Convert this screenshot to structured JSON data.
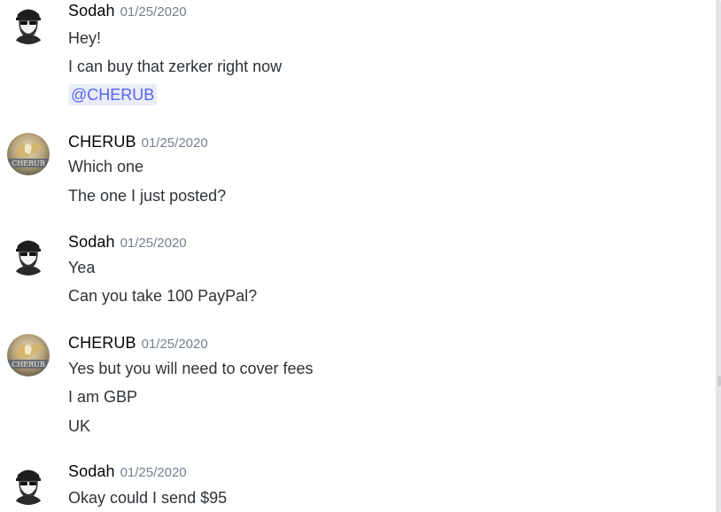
{
  "messages": [
    {
      "author": "Sodah",
      "timestamp": "01/25/2020",
      "avatar": "sodah-avatar",
      "lines": [
        "Hey!",
        "I can buy that zerker right now"
      ],
      "mention": "@CHERUB"
    },
    {
      "author": "CHERUB",
      "timestamp": "01/25/2020",
      "avatar": "cherub-avatar",
      "avatar_text": "CHERUB",
      "lines": [
        "Which one",
        "The one I just posted?"
      ]
    },
    {
      "author": "Sodah",
      "timestamp": "01/25/2020",
      "avatar": "sodah-avatar",
      "lines": [
        "Yea",
        "Can you take 100 PayPal?"
      ]
    },
    {
      "author": "CHERUB",
      "timestamp": "01/25/2020",
      "avatar": "cherub-avatar",
      "avatar_text": "CHERUB",
      "lines": [
        "Yes but you will need to cover fees",
        "I am GBP",
        "UK"
      ]
    },
    {
      "author": "Sodah",
      "timestamp": "01/25/2020",
      "avatar": "sodah-avatar",
      "lines": [
        "Okay could I send $95"
      ]
    }
  ],
  "colors": {
    "mention_bg": "#e9ecf9",
    "mention_text": "#5865f2",
    "timestamp": "#747f8d"
  }
}
